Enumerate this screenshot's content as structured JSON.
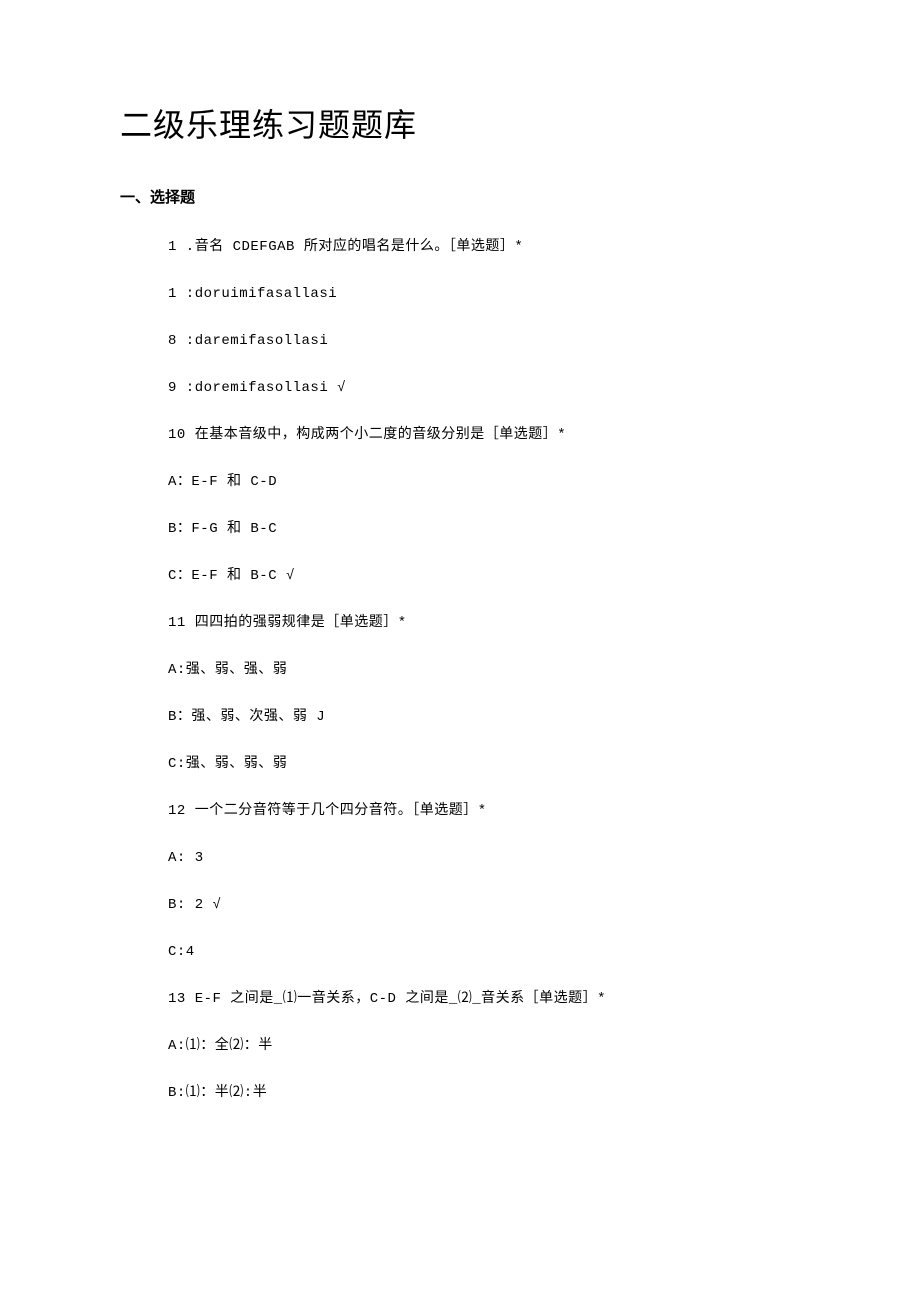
{
  "title": "二级乐理练习题题库",
  "section_heading": "一、选择题",
  "lines": {
    "l1": "1 .音名 CDEFGAB 所对应的唱名是什么。［单选题］*",
    "l2": "1  :doruimifasallasi",
    "l3": "8  :daremifasollasi",
    "l4": "9  :doremifasollasi √",
    "l5": "10 在基本音级中，构成两个小二度的音级分别是［单选题］*",
    "l6": "A：E-F 和 C-D",
    "l7": "B：F-G 和 B-C",
    "l8": "C：E-F 和 B-C √",
    "l9": "11 四四拍的强弱规律是［单选题］*",
    "l10": "A:强、弱、强、弱",
    "l11": "B：强、弱、次强、弱 J",
    "l12": "C:强、弱、弱、弱",
    "l13": "12 一个二分音符等于几个四分音符。［单选题］*",
    "l14": "A:  3",
    "l15": "B:  2 √",
    "l16": "C:4",
    "l17": "13 E-F 之间是_⑴一音关系，C-D 之间是_⑵_音关系［单选题］*",
    "l18": "A:⑴：全⑵：半",
    "l19": "B:⑴：半⑵:半"
  }
}
